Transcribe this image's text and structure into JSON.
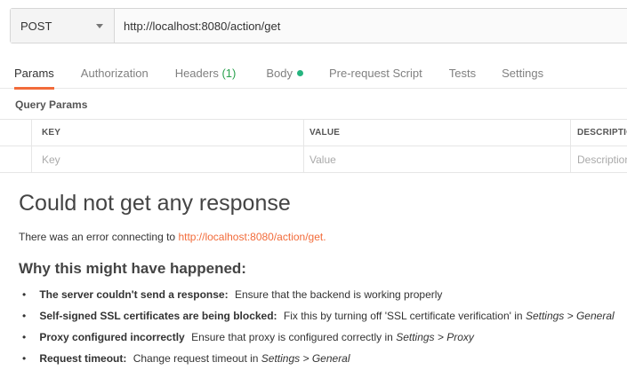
{
  "request": {
    "method": "POST",
    "url": "http://localhost:8080/action/get"
  },
  "tabs": [
    {
      "label": "Params"
    },
    {
      "label": "Authorization"
    },
    {
      "label": "Headers",
      "count": "(1)"
    },
    {
      "label": "Body"
    },
    {
      "label": "Pre-request Script"
    },
    {
      "label": "Tests"
    },
    {
      "label": "Settings"
    }
  ],
  "active_tab": "Params",
  "query_params": {
    "title": "Query Params",
    "headers": [
      "KEY",
      "VALUE",
      "DESCRIPTION"
    ],
    "placeholders": [
      "Key",
      "Value",
      "Description"
    ]
  },
  "response": {
    "title": "Could not get any response",
    "error_prefix": "There was an error connecting to ",
    "error_link": "http://localhost:8080/action/get.",
    "why_title": "Why this might have happened:",
    "reasons": [
      {
        "bold": "The server couldn't send a response:",
        "text": "Ensure that the backend is working properly"
      },
      {
        "bold": "Self-signed SSL certificates are being blocked:",
        "text": "Fix this by turning off 'SSL certificate verification' in ",
        "italic": "Settings > General"
      },
      {
        "bold": "Proxy configured incorrectly",
        "text": "Ensure that proxy is configured correctly in ",
        "italic": "Settings > Proxy"
      },
      {
        "bold": "Request timeout:",
        "text": "Change request timeout in ",
        "italic": "Settings > General"
      }
    ]
  },
  "colors": {
    "accent": "#f26b3a",
    "body_dot": "#26b47f",
    "headers_count": "#2aa14e"
  }
}
